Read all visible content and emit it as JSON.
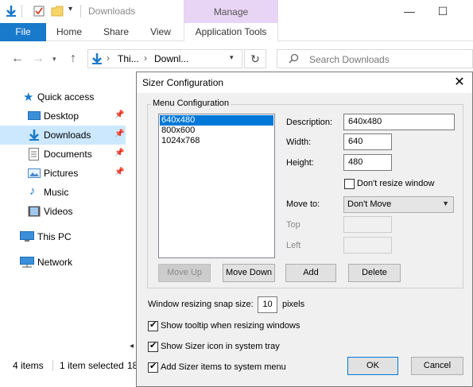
{
  "explorer": {
    "title": "Downloads",
    "contextual_tab_group": "Manage",
    "tabs": {
      "file": "File",
      "home": "Home",
      "share": "Share",
      "view": "View",
      "application_tools": "Application Tools"
    },
    "address": {
      "segment1": "Thi...",
      "segment2": "Downl...",
      "search_placeholder": "Search Downloads"
    },
    "sidebar": {
      "quick_access": "Quick access",
      "desktop": "Desktop",
      "downloads": "Downloads",
      "documents": "Documents",
      "pictures": "Pictures",
      "music": "Music",
      "videos": "Videos",
      "this_pc": "This PC",
      "network": "Network"
    },
    "status": {
      "items": "4 items",
      "selected": "1 item selected",
      "size_fragment": "18"
    },
    "colors": {
      "accent": "#1979ca",
      "manage_tab": "#e8d4f4",
      "selection": "#cce8ff"
    }
  },
  "dialog": {
    "title": "Sizer Configuration",
    "group_label": "Menu Configuration",
    "menu_items": [
      "640x480",
      "800x600",
      "1024x768"
    ],
    "selected_item": "640x480",
    "fields": {
      "description_label": "Description:",
      "description_value": "640x480",
      "width_label": "Width:",
      "width_value": "640",
      "height_label": "Height:",
      "height_value": "480",
      "dont_resize_label": "Don't resize window",
      "dont_resize_checked": false,
      "move_to_label": "Move to:",
      "move_to_value": "Don't Move",
      "top_label": "Top",
      "left_label": "Left"
    },
    "buttons": {
      "move_up": "Move Up",
      "move_down": "Move Down",
      "add": "Add",
      "delete": "Delete",
      "ok": "OK",
      "cancel": "Cancel"
    },
    "snap": {
      "label": "Window resizing snap size:",
      "value": "10",
      "unit": "pixels"
    },
    "options": {
      "show_tooltip": "Show tooltip when resizing windows",
      "show_tooltip_checked": true,
      "show_icon": "Show Sizer icon in system tray",
      "show_icon_checked": true,
      "add_items": "Add Sizer items to system menu",
      "add_items_checked": true
    },
    "colors": {
      "selection": "#0078d7",
      "dialog_bg": "#f0f0f0"
    }
  }
}
